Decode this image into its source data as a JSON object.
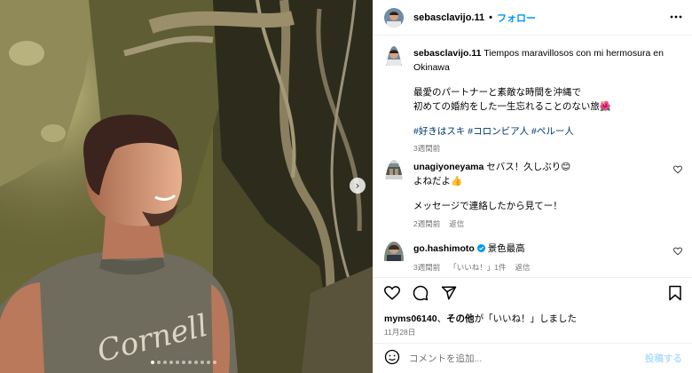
{
  "post": {
    "author": "sebasclavijo.11",
    "follow_label": "フォロー",
    "separator": "•"
  },
  "caption": {
    "author": "sebasclavijo.11",
    "text": "Tiempos maravillosos con mi hermosura en Okinawa",
    "line1": "最愛のパートナーと素敵な時間を沖縄で",
    "line2": "初めての婚約をした一生忘れることのない旅🌺",
    "hashtags": [
      "#好きはスキ",
      "#コロンビア人",
      "#ペルー人"
    ],
    "time": "3週間前"
  },
  "comments": [
    {
      "user": "unagiyoneyama",
      "line1": "セバス！久しぶり😊",
      "line2": "よねだよ👍",
      "line3": "メッセージで連絡したから見てー！",
      "time": "2週間前",
      "reply": "返信"
    },
    {
      "user": "go.hashimoto",
      "text": "景色最高",
      "verified": true,
      "time": "3週間前",
      "likes": "「いいね！」1件",
      "reply": "返信"
    }
  ],
  "likes": {
    "user": "myms06140",
    "connector": "、",
    "others": "その他",
    "suffix": "が「いいね！」しました"
  },
  "date": "11月28日",
  "comment_box": {
    "placeholder": "コメントを追加...",
    "post_label": "投稿する"
  },
  "icons": {
    "more": "more-horizontal-icon",
    "heart": "heart-icon",
    "comment": "comment-icon",
    "share": "share-icon",
    "bookmark": "bookmark-icon",
    "emoji": "emoji-icon",
    "verified": "verified-badge-icon",
    "next": "chevron-right-icon"
  },
  "colors": {
    "accent": "#0095f6",
    "hashtag": "#00376b",
    "muted": "#737373",
    "post_disabled": "#b2dffc",
    "verified": "#0095f6"
  },
  "carousel": {
    "slide_count": 11,
    "current_index": 1
  }
}
